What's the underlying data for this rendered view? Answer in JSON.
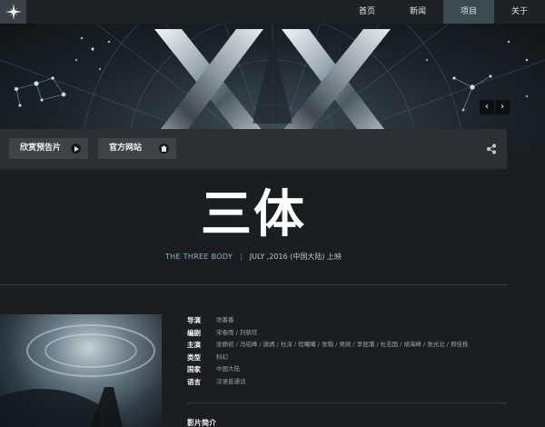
{
  "nav": {
    "logo_icon": "star-burst-icon",
    "items": [
      {
        "label": "首页"
      },
      {
        "label": "新闻"
      },
      {
        "label": "项目",
        "active": true
      },
      {
        "label": "关于"
      }
    ]
  },
  "banner": {
    "logo_letters": "XX",
    "prev_label": "‹",
    "next_label": "›"
  },
  "actions": {
    "trailer_label": "欣赏预告片",
    "trailer_icon": "play-icon",
    "website_label": "官方网站",
    "website_icon": "home-icon",
    "share_icon": "share-icon"
  },
  "movie": {
    "title": "三体",
    "english_title": "THE THREE BODY",
    "release": "JULY ,2016 (中国大陆) 上映"
  },
  "details": {
    "rows": [
      {
        "key": "导演",
        "value": "张番番"
      },
      {
        "key": "编剧",
        "value": "宋春雨 / 刘慈欣"
      },
      {
        "key": "主演",
        "value": "张静初 / 冯绍峰 / 唐嫣 / 杜淳 / 程曦曦 / 张翰 / 吴刚 / 李琵蒲 / 杜志国 / 胡海峰 / 张光北 / 邢佳栋"
      },
      {
        "key": "类型",
        "value": "科幻"
      },
      {
        "key": "国家",
        "value": "中国大陆"
      },
      {
        "key": "语言",
        "value": "汉语普通话"
      }
    ],
    "intro_heading": "影片简介"
  },
  "colors": {
    "background": "#1b1e20",
    "nav_active": "#3b4a4e",
    "accent_text": "#8fb6c9"
  }
}
